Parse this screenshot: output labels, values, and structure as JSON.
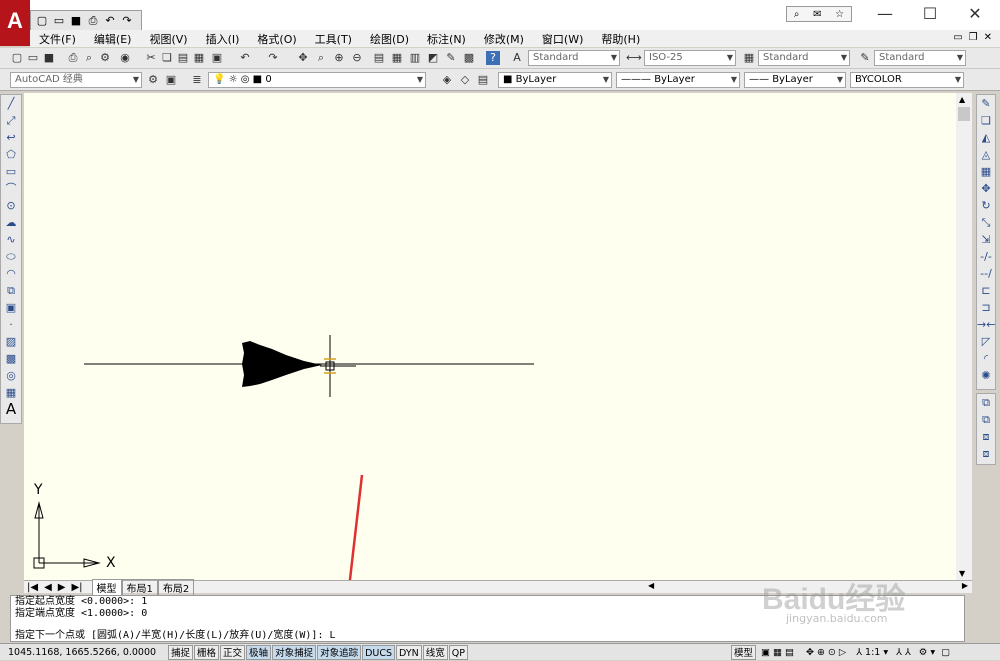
{
  "app": {
    "logo_letter": "A"
  },
  "quick_access": [
    "new-icon",
    "open-icon",
    "save-icon",
    "print-icon",
    "undo-icon",
    "redo-icon"
  ],
  "menu": [
    "文件(F)",
    "编辑(E)",
    "视图(V)",
    "插入(I)",
    "格式(O)",
    "工具(T)",
    "绘图(D)",
    "标注(N)",
    "修改(M)",
    "窗口(W)",
    "帮助(H)"
  ],
  "toolbar": {
    "text_style": "Standard",
    "dim_style": "ISO-25",
    "table_style": "Standard",
    "mleader_style": "Standard",
    "workspace": "AutoCAD 经典",
    "layer": "0",
    "color": "ByLayer",
    "linetype": "ByLayer",
    "lineweight": "ByLayer",
    "plot_style": "BYCOLOR"
  },
  "ucs": {
    "y_label": "Y",
    "x_label": "X"
  },
  "layout_tabs": [
    "模型",
    "布局1",
    "布局2"
  ],
  "command": {
    "history": [
      "指定起点宽度 <0.0000>: 1",
      "指定端点宽度 <1.0000>: 0"
    ],
    "prompt": "指定下一个点或 [圆弧(A)/半宽(H)/长度(L)/放弃(U)/宽度(W)]: L"
  },
  "status": {
    "coords": "1045.1168, 1665.5266, 0.0000",
    "toggles": [
      {
        "label": "捕捉",
        "on": false
      },
      {
        "label": "栅格",
        "on": false
      },
      {
        "label": "正交",
        "on": false
      },
      {
        "label": "极轴",
        "on": true
      },
      {
        "label": "对象捕捉",
        "on": true
      },
      {
        "label": "对象追踪",
        "on": true
      },
      {
        "label": "DUCS",
        "on": true
      },
      {
        "label": "DYN",
        "on": false
      },
      {
        "label": "线宽",
        "on": false
      },
      {
        "label": "QP",
        "on": false
      }
    ],
    "model_label": "模型",
    "scale": "1:1"
  },
  "watermark": {
    "text": "Baidu经验",
    "sub": "jingyan.baidu.com"
  },
  "colors": {
    "canvas": "#fffff0",
    "annotation_arrow": "#e03030",
    "brand": "#b5141b"
  }
}
